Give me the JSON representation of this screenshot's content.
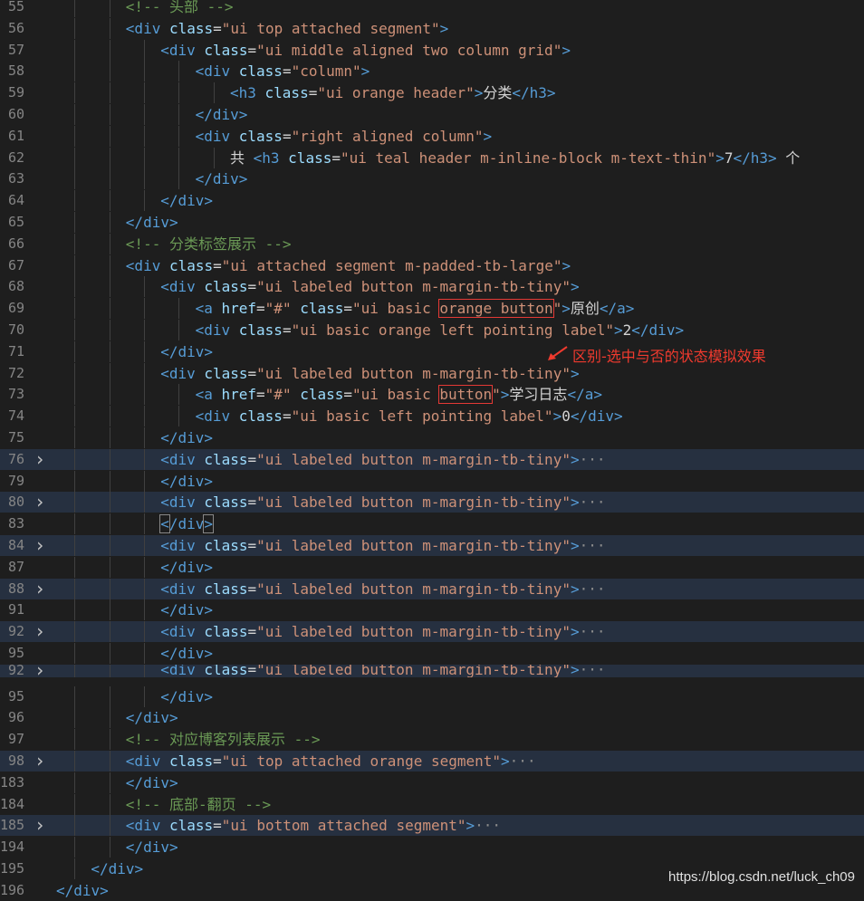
{
  "lines": [
    {
      "n": "55",
      "fold": false,
      "folded": false,
      "indent": 3,
      "tokens": [
        {
          "t": "cmt",
          "v": "<!-- 头部 -->"
        }
      ]
    },
    {
      "n": "56",
      "fold": false,
      "folded": false,
      "indent": 3,
      "tokens": [
        {
          "t": "tag",
          "v": "<div "
        },
        {
          "t": "attr",
          "v": "class"
        },
        {
          "t": "txt",
          "v": "="
        },
        {
          "t": "str",
          "v": "\"ui top attached segment\""
        },
        {
          "t": "tag",
          "v": ">"
        }
      ]
    },
    {
      "n": "57",
      "fold": false,
      "folded": false,
      "indent": 4,
      "tokens": [
        {
          "t": "tag",
          "v": "<div "
        },
        {
          "t": "attr",
          "v": "class"
        },
        {
          "t": "txt",
          "v": "="
        },
        {
          "t": "str",
          "v": "\"ui middle aligned two column grid\""
        },
        {
          "t": "tag",
          "v": ">"
        }
      ]
    },
    {
      "n": "58",
      "fold": false,
      "folded": false,
      "indent": 5,
      "tokens": [
        {
          "t": "tag",
          "v": "<div "
        },
        {
          "t": "attr",
          "v": "class"
        },
        {
          "t": "txt",
          "v": "="
        },
        {
          "t": "str",
          "v": "\"column\""
        },
        {
          "t": "tag",
          "v": ">"
        }
      ]
    },
    {
      "n": "59",
      "fold": false,
      "folded": false,
      "indent": 6,
      "tokens": [
        {
          "t": "tag",
          "v": "<h3 "
        },
        {
          "t": "attr",
          "v": "class"
        },
        {
          "t": "txt",
          "v": "="
        },
        {
          "t": "str",
          "v": "\"ui orange header\""
        },
        {
          "t": "tag",
          "v": ">"
        },
        {
          "t": "txt",
          "v": "分类"
        },
        {
          "t": "tag",
          "v": "</h3>"
        }
      ]
    },
    {
      "n": "60",
      "fold": false,
      "folded": false,
      "indent": 5,
      "tokens": [
        {
          "t": "tag",
          "v": "</div>"
        }
      ]
    },
    {
      "n": "61",
      "fold": false,
      "folded": false,
      "indent": 5,
      "tokens": [
        {
          "t": "tag",
          "v": "<div "
        },
        {
          "t": "attr",
          "v": "class"
        },
        {
          "t": "txt",
          "v": "="
        },
        {
          "t": "str",
          "v": "\"right aligned column\""
        },
        {
          "t": "tag",
          "v": ">"
        }
      ]
    },
    {
      "n": "62",
      "fold": false,
      "folded": false,
      "indent": 6,
      "tokens": [
        {
          "t": "txt",
          "v": "共 "
        },
        {
          "t": "tag",
          "v": "<h3 "
        },
        {
          "t": "attr",
          "v": "class"
        },
        {
          "t": "txt",
          "v": "="
        },
        {
          "t": "str",
          "v": "\"ui teal header m-inline-block m-text-thin\""
        },
        {
          "t": "tag",
          "v": ">"
        },
        {
          "t": "txt",
          "v": "7"
        },
        {
          "t": "tag",
          "v": "</h3>"
        },
        {
          "t": "txt",
          "v": " 个"
        }
      ]
    },
    {
      "n": "63",
      "fold": false,
      "folded": false,
      "indent": 5,
      "tokens": [
        {
          "t": "tag",
          "v": "</div>"
        }
      ]
    },
    {
      "n": "64",
      "fold": false,
      "folded": false,
      "indent": 4,
      "tokens": [
        {
          "t": "tag",
          "v": "</div>"
        }
      ]
    },
    {
      "n": "65",
      "fold": false,
      "folded": false,
      "indent": 3,
      "tokens": [
        {
          "t": "tag",
          "v": "</div>"
        }
      ]
    },
    {
      "n": "66",
      "fold": false,
      "folded": false,
      "indent": 3,
      "tokens": [
        {
          "t": "cmt",
          "v": "<!-- 分类标签展示 -->"
        }
      ]
    },
    {
      "n": "67",
      "fold": false,
      "folded": false,
      "indent": 3,
      "tokens": [
        {
          "t": "tag",
          "v": "<div "
        },
        {
          "t": "attr",
          "v": "class"
        },
        {
          "t": "txt",
          "v": "="
        },
        {
          "t": "str",
          "v": "\"ui attached segment m-padded-tb-large\""
        },
        {
          "t": "tag",
          "v": ">"
        }
      ]
    },
    {
      "n": "68",
      "fold": false,
      "folded": false,
      "indent": 4,
      "tokens": [
        {
          "t": "tag",
          "v": "<div "
        },
        {
          "t": "attr",
          "v": "class"
        },
        {
          "t": "txt",
          "v": "="
        },
        {
          "t": "str",
          "v": "\"ui labeled button m-margin-tb-tiny\""
        },
        {
          "t": "tag",
          "v": ">"
        }
      ]
    },
    {
      "n": "69",
      "fold": false,
      "folded": false,
      "indent": 5,
      "tokens": [
        {
          "t": "tag",
          "v": "<a "
        },
        {
          "t": "attr",
          "v": "href"
        },
        {
          "t": "txt",
          "v": "="
        },
        {
          "t": "str",
          "v": "\"#\" "
        },
        {
          "t": "attr",
          "v": "class"
        },
        {
          "t": "txt",
          "v": "="
        },
        {
          "t": "str",
          "v": "\"ui basic "
        },
        {
          "t": "str",
          "v": "orange button",
          "box": true
        },
        {
          "t": "str",
          "v": "\""
        },
        {
          "t": "tag",
          "v": ">"
        },
        {
          "t": "txt",
          "v": "原创"
        },
        {
          "t": "tag",
          "v": "</a>"
        }
      ]
    },
    {
      "n": "70",
      "fold": false,
      "folded": false,
      "indent": 5,
      "tokens": [
        {
          "t": "tag",
          "v": "<div "
        },
        {
          "t": "attr",
          "v": "class"
        },
        {
          "t": "txt",
          "v": "="
        },
        {
          "t": "str",
          "v": "\"ui basic orange left pointing label\""
        },
        {
          "t": "tag",
          "v": ">"
        },
        {
          "t": "txt",
          "v": "2"
        },
        {
          "t": "tag",
          "v": "</div>"
        }
      ]
    },
    {
      "n": "71",
      "fold": false,
      "folded": false,
      "indent": 4,
      "tokens": [
        {
          "t": "tag",
          "v": "</div>"
        }
      ]
    },
    {
      "n": "72",
      "fold": false,
      "folded": false,
      "indent": 4,
      "tokens": [
        {
          "t": "tag",
          "v": "<div "
        },
        {
          "t": "attr",
          "v": "class"
        },
        {
          "t": "txt",
          "v": "="
        },
        {
          "t": "str",
          "v": "\"ui labeled button m-margin-tb-tiny\""
        },
        {
          "t": "tag",
          "v": ">"
        }
      ]
    },
    {
      "n": "73",
      "fold": false,
      "folded": false,
      "indent": 5,
      "tokens": [
        {
          "t": "tag",
          "v": "<a "
        },
        {
          "t": "attr",
          "v": "href"
        },
        {
          "t": "txt",
          "v": "="
        },
        {
          "t": "str",
          "v": "\"#\" "
        },
        {
          "t": "attr",
          "v": "class"
        },
        {
          "t": "txt",
          "v": "="
        },
        {
          "t": "str",
          "v": "\"ui basic "
        },
        {
          "t": "str",
          "v": "button",
          "box": true
        },
        {
          "t": "str",
          "v": "\""
        },
        {
          "t": "tag",
          "v": ">"
        },
        {
          "t": "txt",
          "v": "学习日志"
        },
        {
          "t": "tag",
          "v": "</a>"
        }
      ]
    },
    {
      "n": "74",
      "fold": false,
      "folded": false,
      "indent": 5,
      "tokens": [
        {
          "t": "tag",
          "v": "<div "
        },
        {
          "t": "attr",
          "v": "class"
        },
        {
          "t": "txt",
          "v": "="
        },
        {
          "t": "str",
          "v": "\"ui basic left pointing label\""
        },
        {
          "t": "tag",
          "v": ">"
        },
        {
          "t": "txt",
          "v": "0"
        },
        {
          "t": "tag",
          "v": "</div>"
        }
      ]
    },
    {
      "n": "75",
      "fold": false,
      "folded": false,
      "indent": 4,
      "tokens": [
        {
          "t": "tag",
          "v": "</div>"
        }
      ]
    },
    {
      "n": "76",
      "fold": true,
      "folded": true,
      "indent": 4,
      "tokens": [
        {
          "t": "tag",
          "v": "<div "
        },
        {
          "t": "attr",
          "v": "class"
        },
        {
          "t": "txt",
          "v": "="
        },
        {
          "t": "str",
          "v": "\"ui labeled button m-margin-tb-tiny\""
        },
        {
          "t": "tag",
          "v": ">"
        },
        {
          "t": "ell",
          "v": "···"
        }
      ]
    },
    {
      "n": "79",
      "fold": false,
      "folded": false,
      "indent": 4,
      "tokens": [
        {
          "t": "tag",
          "v": "</div>"
        }
      ]
    },
    {
      "n": "80",
      "fold": true,
      "folded": true,
      "indent": 4,
      "tokens": [
        {
          "t": "tag",
          "v": "<div "
        },
        {
          "t": "attr",
          "v": "class"
        },
        {
          "t": "txt",
          "v": "="
        },
        {
          "t": "str",
          "v": "\"ui labeled button m-margin-tb-tiny\""
        },
        {
          "t": "tag",
          "v": ">"
        },
        {
          "t": "ell",
          "v": "···"
        }
      ]
    },
    {
      "n": "83",
      "fold": false,
      "folded": false,
      "indent": 4,
      "tokens": [
        {
          "t": "tag",
          "v": "<",
          "hl": true
        },
        {
          "t": "tag",
          "v": "/div"
        },
        {
          "t": "tag",
          "v": ">",
          "hl": true
        }
      ]
    },
    {
      "n": "84",
      "fold": true,
      "folded": true,
      "indent": 4,
      "tokens": [
        {
          "t": "tag",
          "v": "<div "
        },
        {
          "t": "attr",
          "v": "class"
        },
        {
          "t": "txt",
          "v": "="
        },
        {
          "t": "str",
          "v": "\"ui labeled button m-margin-tb-tiny\""
        },
        {
          "t": "tag",
          "v": ">"
        },
        {
          "t": "ell",
          "v": "···"
        }
      ]
    },
    {
      "n": "87",
      "fold": false,
      "folded": false,
      "indent": 4,
      "tokens": [
        {
          "t": "tag",
          "v": "</div>"
        }
      ]
    },
    {
      "n": "88",
      "fold": true,
      "folded": true,
      "indent": 4,
      "tokens": [
        {
          "t": "tag",
          "v": "<div "
        },
        {
          "t": "attr",
          "v": "class"
        },
        {
          "t": "txt",
          "v": "="
        },
        {
          "t": "str",
          "v": "\"ui labeled button m-margin-tb-tiny\""
        },
        {
          "t": "tag",
          "v": ">"
        },
        {
          "t": "ell",
          "v": "···"
        }
      ]
    },
    {
      "n": "91",
      "fold": false,
      "folded": false,
      "indent": 4,
      "tokens": [
        {
          "t": "tag",
          "v": "</div>"
        }
      ]
    },
    {
      "n": "92",
      "fold": true,
      "folded": true,
      "indent": 4,
      "tokens": [
        {
          "t": "tag",
          "v": "<div "
        },
        {
          "t": "attr",
          "v": "class"
        },
        {
          "t": "txt",
          "v": "="
        },
        {
          "t": "str",
          "v": "\"ui labeled button m-margin-tb-tiny\""
        },
        {
          "t": "tag",
          "v": ">"
        },
        {
          "t": "ell",
          "v": "···"
        }
      ]
    },
    {
      "n": "95",
      "fold": false,
      "folded": false,
      "indent": 4,
      "tokens": [
        {
          "t": "tag",
          "v": "</div>"
        }
      ]
    },
    {
      "n": "92",
      "fold": true,
      "folded": true,
      "partial": true,
      "indent": 4,
      "tokens": [
        {
          "t": "tag",
          "v": "<div "
        },
        {
          "t": "attr",
          "v": "class"
        },
        {
          "t": "txt",
          "v": "="
        },
        {
          "t": "str",
          "v": "\"ui labeled button m-margin-tb-tiny\""
        },
        {
          "t": "tag",
          "v": ">"
        },
        {
          "t": "ell",
          "v": "···"
        }
      ]
    },
    {
      "n": "95",
      "fold": false,
      "folded": false,
      "indent": 4,
      "tokens": [
        {
          "t": "tag",
          "v": "</div>"
        }
      ]
    },
    {
      "n": "96",
      "fold": false,
      "folded": false,
      "indent": 3,
      "tokens": [
        {
          "t": "tag",
          "v": "</div>"
        }
      ]
    },
    {
      "n": "97",
      "fold": false,
      "folded": false,
      "indent": 3,
      "tokens": [
        {
          "t": "cmt",
          "v": "<!-- 对应博客列表展示 -->"
        }
      ]
    },
    {
      "n": "98",
      "fold": true,
      "folded": true,
      "indent": 3,
      "tokens": [
        {
          "t": "tag",
          "v": "<div "
        },
        {
          "t": "attr",
          "v": "class"
        },
        {
          "t": "txt",
          "v": "="
        },
        {
          "t": "str",
          "v": "\"ui top attached orange segment\""
        },
        {
          "t": "tag",
          "v": ">"
        },
        {
          "t": "ell",
          "v": "···"
        }
      ]
    },
    {
      "n": "183",
      "fold": false,
      "folded": false,
      "indent": 3,
      "tokens": [
        {
          "t": "tag",
          "v": "</div>"
        }
      ]
    },
    {
      "n": "184",
      "fold": false,
      "folded": false,
      "indent": 3,
      "tokens": [
        {
          "t": "cmt",
          "v": "<!-- 底部-翻页 -->"
        }
      ]
    },
    {
      "n": "185",
      "fold": true,
      "folded": true,
      "indent": 3,
      "tokens": [
        {
          "t": "tag",
          "v": "<div "
        },
        {
          "t": "attr",
          "v": "class"
        },
        {
          "t": "txt",
          "v": "="
        },
        {
          "t": "str",
          "v": "\"ui bottom attached segment\""
        },
        {
          "t": "tag",
          "v": ">"
        },
        {
          "t": "ell",
          "v": "···"
        }
      ]
    },
    {
      "n": "194",
      "fold": false,
      "folded": false,
      "indent": 3,
      "tokens": [
        {
          "t": "tag",
          "v": "</div>"
        }
      ]
    },
    {
      "n": "195",
      "fold": false,
      "folded": false,
      "indent": 2,
      "tokens": [
        {
          "t": "tag",
          "v": "</div>"
        }
      ]
    },
    {
      "n": "196",
      "fold": false,
      "folded": false,
      "indent": 1,
      "tokens": [
        {
          "t": "tag",
          "v": "</div>"
        }
      ]
    }
  ],
  "annotation": "区别-选中与否的状态模拟效果",
  "watermark": "https://blog.csdn.net/luck_ch09",
  "colors": {
    "background": "#1e1e1e",
    "tag": "#569cd6",
    "attribute": "#9cdcfe",
    "string": "#ce9178",
    "comment": "#6a9955",
    "annotation": "#f03a2e",
    "folded_line": "#263040"
  },
  "icons": {
    "fold": "chevron-right-icon"
  }
}
